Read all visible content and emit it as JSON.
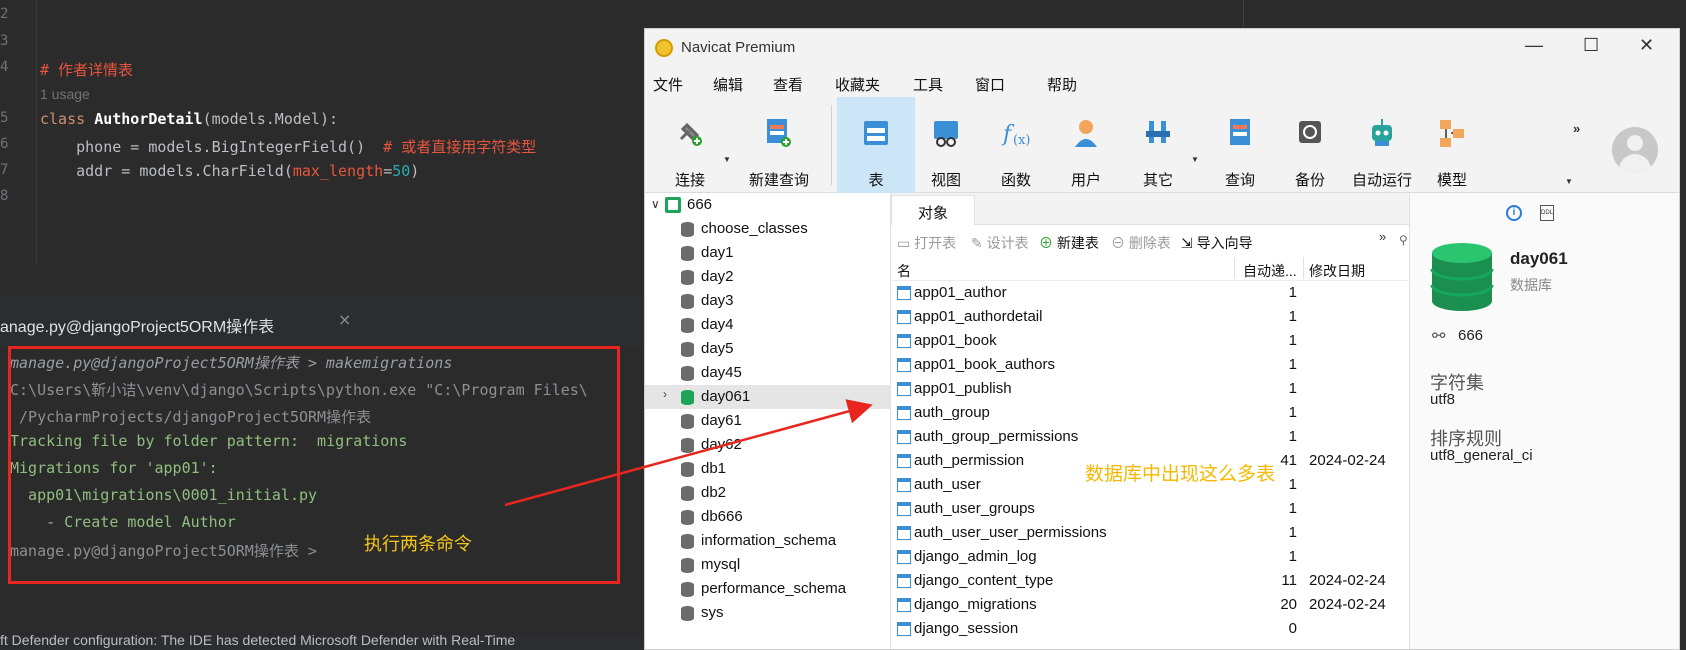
{
  "editor": {
    "line_numbers": [
      "2",
      "3",
      "4",
      "",
      "5",
      "6",
      "7",
      "8"
    ],
    "comment_line": "# 作者详情表",
    "usage": "1 usage",
    "class_kw": "class",
    "class_name": "AuthorDetail",
    "class_base": "(models.Model):",
    "phone_line": "    phone = models.BigIntegerField()  ",
    "phone_comment": "# 或者直接用字符类型",
    "addr_prefix": "    addr = models.CharField(",
    "addr_param": "max_length",
    "addr_eq": "=",
    "addr_num": "50",
    "addr_close": ")"
  },
  "terminal": {
    "tab_title": "anage.py@djangoProject5ORM操作表",
    "close_glyph": "×",
    "lines": [
      "manage.py@djangoProject5ORM操作表 > makemigrations",
      "C:\\Users\\靳小诘\\venv\\django\\Scripts\\python.exe \"C:\\Program Files\\",
      " /PycharmProjects/djangoProject5ORM操作表",
      "Tracking file by folder pattern:  migrations",
      "Migrations for 'app01':",
      "  app01\\migrations\\0001_initial.py",
      "    - Create model Author",
      "manage.py@djangoProject5ORM操作表 > "
    ],
    "annotation": "执行两条命令",
    "status_text": "ft Defender configuration: The IDE has detected Microsoft Defender with Real-Time"
  },
  "navicat": {
    "title": "Navicat Premium",
    "window_buttons": [
      "—",
      "☐",
      "✕"
    ],
    "menu": [
      "文件",
      "编辑",
      "查看",
      "收藏夹",
      "工具",
      "窗口",
      "帮助"
    ],
    "toolbar": {
      "connect": "连接",
      "new_query": "新建查询",
      "table": "表",
      "view": "视图",
      "function": "函数",
      "user": "用户",
      "other": "其它",
      "query": "查询",
      "backup": "备份",
      "auto_run": "自动运行",
      "model": "模型",
      "more": "»"
    },
    "tree": {
      "connection": "666",
      "databases": [
        "choose_classes",
        "day1",
        "day2",
        "day3",
        "day4",
        "day5",
        "day45",
        "day061",
        "day61",
        "day62",
        "db1",
        "db2",
        "db666",
        "information_schema",
        "mysql",
        "performance_schema",
        "sys"
      ],
      "selected": "day061"
    },
    "objects": {
      "tab": "对象",
      "toolbar": {
        "open": "打开表",
        "design": "设计表",
        "new": "新建表",
        "delete": "删除表",
        "import": "导入向导",
        "more": "»"
      },
      "columns": [
        "名",
        "自动递...",
        "修改日期"
      ],
      "rows": [
        {
          "name": "app01_author",
          "auto": "1",
          "date": ""
        },
        {
          "name": "app01_authordetail",
          "auto": "1",
          "date": ""
        },
        {
          "name": "app01_book",
          "auto": "1",
          "date": ""
        },
        {
          "name": "app01_book_authors",
          "auto": "1",
          "date": ""
        },
        {
          "name": "app01_publish",
          "auto": "1",
          "date": ""
        },
        {
          "name": "auth_group",
          "auto": "1",
          "date": ""
        },
        {
          "name": "auth_group_permissions",
          "auto": "1",
          "date": ""
        },
        {
          "name": "auth_permission",
          "auto": "41",
          "date": "2024-02-24"
        },
        {
          "name": "auth_user",
          "auto": "1",
          "date": ""
        },
        {
          "name": "auth_user_groups",
          "auto": "1",
          "date": ""
        },
        {
          "name": "auth_user_user_permissions",
          "auto": "1",
          "date": ""
        },
        {
          "name": "django_admin_log",
          "auto": "1",
          "date": ""
        },
        {
          "name": "django_content_type",
          "auto": "11",
          "date": "2024-02-24"
        },
        {
          "name": "django_migrations",
          "auto": "20",
          "date": "2024-02-24"
        },
        {
          "name": "django_session",
          "auto": "0",
          "date": ""
        }
      ],
      "annotation": "数据库中出现这么多表"
    },
    "info": {
      "db_name": "day061",
      "db_type": "数据库",
      "connection": "666",
      "charset_label": "字符集",
      "charset": "utf8",
      "collation_label": "排序规则",
      "collation": "utf8_general_ci",
      "ddl": "DDL"
    }
  },
  "colors": {
    "annotation_red": "#e8261f",
    "annotation_yellow": "#f5c518",
    "active_tab": "#cde6f7",
    "db_green": "#1fa35b"
  }
}
